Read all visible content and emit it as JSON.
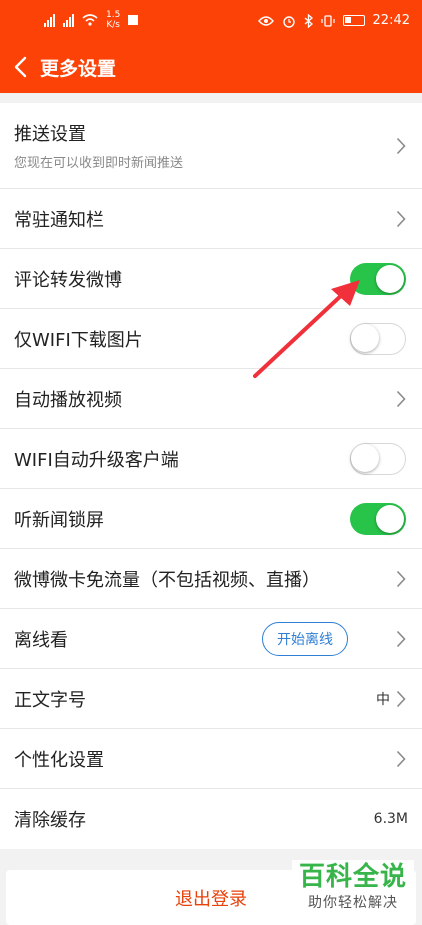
{
  "status_bar": {
    "signal1": "⁴⁶",
    "signal2": "⁴⁶",
    "speed_value": "1.5",
    "speed_unit": "K/s",
    "time": "22:42"
  },
  "header": {
    "title": "更多设置"
  },
  "settings": [
    {
      "label": "推送设置",
      "subtitle": "您现在可以收到即时新闻推送",
      "control": "chevron"
    },
    {
      "label": "常驻通知栏",
      "control": "chevron"
    },
    {
      "label": "评论转发微博",
      "control": "toggle",
      "on": true
    },
    {
      "label": "仅WIFI下载图片",
      "control": "toggle",
      "on": false
    },
    {
      "label": "自动播放视频",
      "control": "chevron"
    },
    {
      "label": "WIFI自动升级客户端",
      "control": "toggle",
      "on": false
    },
    {
      "label": "听新闻锁屏",
      "control": "toggle",
      "on": true
    },
    {
      "label": "微博微卡免流量（不包括视频、直播）",
      "control": "chevron"
    },
    {
      "label": "离线看",
      "button": "开始离线",
      "control": "chevron"
    },
    {
      "label": "正文字号",
      "value": "中",
      "control": "chevron"
    },
    {
      "label": "个性化设置",
      "control": "chevron"
    },
    {
      "label": "清除缓存",
      "value": "6.3M",
      "control": "none"
    }
  ],
  "logout_label": "退出登录",
  "watermark": {
    "line1": "百科全说",
    "line2": "助你轻松解决"
  },
  "colors": {
    "header_bg": "#fc4207",
    "toggle_on": "#28c44a",
    "pill_blue": "#2f7fd6",
    "logout_text": "#e8410a",
    "annotation_arrow": "#f0303a"
  }
}
